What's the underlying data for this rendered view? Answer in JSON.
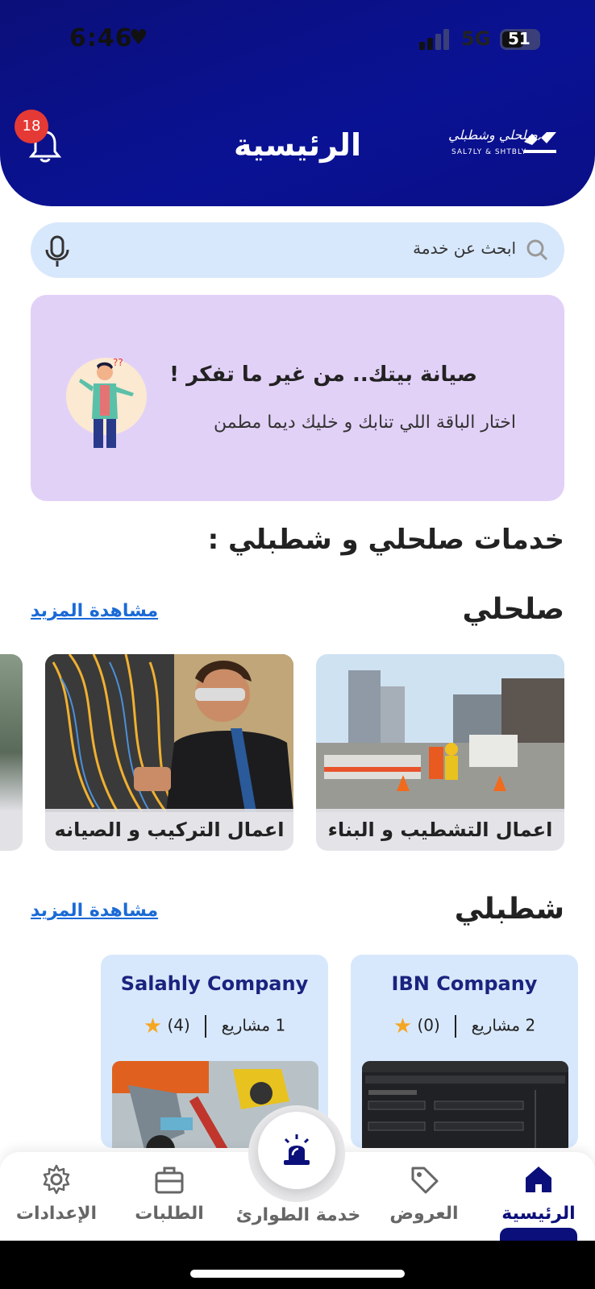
{
  "status_bar": {
    "time": "6:46",
    "network": "5G",
    "battery": "51"
  },
  "header": {
    "title": "الرئيسية",
    "notification_count": "18",
    "logo_ar": "صلحلي وشطبلي",
    "logo_en": "SAL7LY & SHTBLY"
  },
  "search": {
    "placeholder": "ابحث عن خدمة"
  },
  "banner": {
    "title": "صيانة بيتك.. من غير ما تفكر !",
    "subtitle": "اختار الباقة اللي تنابك و خليك ديما مطمن"
  },
  "services_heading": "خدمات صلحلي و شطبلي :",
  "categories": [
    {
      "title": "صلحلي",
      "see_more": "مشاهدة المزيد",
      "items": [
        {
          "label": "اعمال التشطيب و البناء"
        },
        {
          "label": "اعمال التركيب و الصيانه"
        }
      ]
    },
    {
      "title": "شطبلي",
      "see_more": "مشاهدة المزيد",
      "companies": [
        {
          "name": "IBN Company",
          "rating": "(0)",
          "projects": "2 مشاريع"
        },
        {
          "name": "Salahly Company",
          "rating": "(4)",
          "projects": "1 مشاريع"
        }
      ]
    }
  ],
  "bottom_nav": {
    "items": [
      {
        "label": "الرئيسية",
        "icon": "home-icon",
        "active": true
      },
      {
        "label": "العروض",
        "icon": "tag-icon"
      },
      {
        "label": "خدمة الطوارئ",
        "icon": "siren-icon"
      },
      {
        "label": "الطلبات",
        "icon": "briefcase-icon"
      },
      {
        "label": "الإعدادات",
        "icon": "gear-icon"
      }
    ]
  },
  "colors": {
    "primary": "#0b0f7a",
    "search_bg": "#d8e8fc",
    "banner_bg": "#e2d1f7",
    "link": "#1a6ad6",
    "badge": "#e53935",
    "star": "#f5a623"
  }
}
